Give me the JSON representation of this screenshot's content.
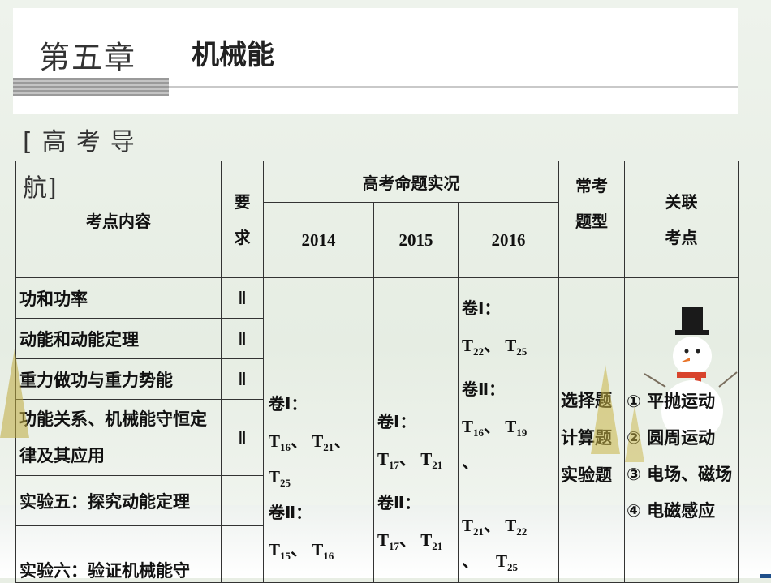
{
  "header": {
    "chapter": "第五章",
    "subject": "机械能"
  },
  "section": {
    "title_a": "[高考导",
    "title_b": "航]"
  },
  "table": {
    "h_content": "考点内容",
    "h_req_a": "要",
    "h_req_b": "求",
    "h_exam": "高考命题实况",
    "h_types_a": "常考",
    "h_types_b": "题型",
    "h_rel_a": "关联",
    "h_rel_b": "考点",
    "years": [
      "2014",
      "2015",
      "2016"
    ],
    "rows": [
      {
        "content": "功和功率",
        "req": "Ⅱ"
      },
      {
        "content": "动能和动能定理",
        "req": "Ⅱ"
      },
      {
        "content": "重力做功与重力势能",
        "req": "Ⅱ"
      },
      {
        "content": "功能关系、机械能守恒定律及其应用",
        "req": "Ⅱ"
      },
      {
        "content": "实验五：探究动能定理",
        "req": ""
      },
      {
        "content": "实验六：验证机械能守",
        "req": ""
      }
    ],
    "y2014": {
      "v1": "卷Ⅰ：",
      "a": "T",
      "a_sub": "16",
      "sep1": "、",
      "b": "T",
      "b_sub": "21",
      "sep2": "、",
      "c": "T",
      "c_sub": "25",
      "v2": "卷Ⅱ：",
      "d": "T",
      "d_sub": "15",
      "sep3": "、",
      "e": "T",
      "e_sub": "16"
    },
    "y2015": {
      "v1": "卷Ⅰ：",
      "a": "T",
      "a_sub": "17",
      "sep1": "、",
      "b": "T",
      "b_sub": "21",
      "v2": "卷Ⅱ：",
      "c": "T",
      "c_sub": "17",
      "sep2": "、",
      "d": "T",
      "d_sub": "21"
    },
    "y2016": {
      "v1": "卷Ⅰ：",
      "a": "T",
      "a_sub": "22",
      "sep1": "、",
      "b": "T",
      "b_sub": "25",
      "v2": "卷Ⅱ：",
      "c": "T",
      "c_sub": "16",
      "sep2": "、",
      "d": "T",
      "d_sub": "19",
      "sep3": "、",
      "e": "T",
      "e_sub": "21",
      "sep4": "、",
      "f": "T",
      "f_sub": "22",
      "sep5": "、",
      "g": "T",
      "g_sub": "25"
    },
    "types": [
      "选择题",
      "计算题",
      "实验题"
    ],
    "related": [
      "① 平抛运动",
      "② 圆周运动",
      "③ 电场、磁场",
      "④ 电磁感应"
    ]
  }
}
